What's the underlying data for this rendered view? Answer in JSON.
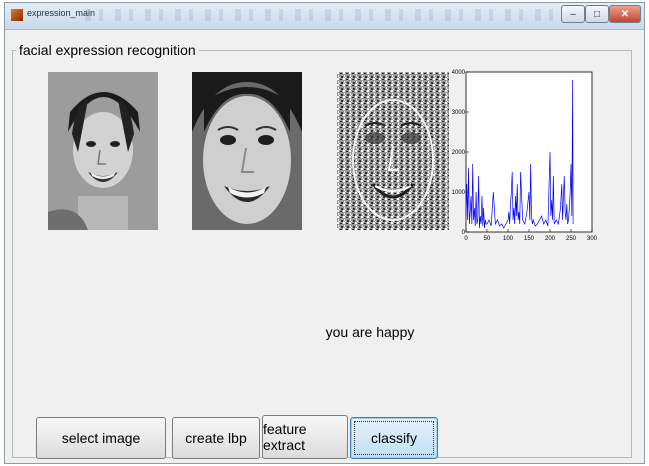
{
  "window": {
    "title": "expression_main"
  },
  "panel": {
    "title": "facial expression recognition"
  },
  "result_text": "you are happy",
  "buttons": {
    "select_image": "select image",
    "create_lbp": "create  lbp",
    "feature_extract": "feature extract",
    "classify": "classify"
  },
  "colors": {
    "series": "#0000ff",
    "classify_button_border": "#3c7fb1"
  },
  "chart_data": {
    "type": "line",
    "title": "",
    "xlabel": "",
    "ylabel": "",
    "xlim": [
      0,
      300
    ],
    "ylim": [
      0,
      4000
    ],
    "xticks": [
      0,
      50,
      100,
      150,
      200,
      250,
      300
    ],
    "yticks": [
      0,
      1000,
      2000,
      3000,
      4000
    ],
    "series": [
      {
        "x": [
          0,
          2,
          4,
          6,
          8,
          10,
          12,
          14,
          16,
          18,
          20,
          22,
          24,
          26,
          28,
          30,
          32,
          34,
          36,
          38,
          40,
          42,
          44,
          46,
          48,
          50,
          55,
          60,
          65,
          70,
          75,
          80,
          85,
          90,
          95,
          100,
          102,
          104,
          106,
          108,
          110,
          112,
          114,
          116,
          118,
          120,
          122,
          124,
          126,
          128,
          130,
          135,
          140,
          145,
          150,
          152,
          154,
          156,
          158,
          160,
          165,
          170,
          175,
          180,
          185,
          190,
          195,
          200,
          202,
          204,
          206,
          208,
          210,
          215,
          220,
          225,
          228,
          230,
          232,
          234,
          236,
          238,
          240,
          242,
          244,
          246,
          248,
          250,
          252,
          254,
          255
        ],
        "values": [
          400,
          1200,
          300,
          1600,
          200,
          500,
          900,
          200,
          1700,
          300,
          600,
          150,
          1000,
          200,
          300,
          1400,
          100,
          400,
          200,
          900,
          150,
          600,
          100,
          300,
          200,
          200,
          300,
          150,
          1000,
          200,
          300,
          150,
          200,
          100,
          200,
          300,
          500,
          200,
          700,
          1000,
          1500,
          300,
          600,
          200,
          900,
          400,
          1200,
          300,
          500,
          200,
          1500,
          300,
          200,
          500,
          1000,
          300,
          1700,
          400,
          200,
          300,
          150,
          200,
          300,
          400,
          200,
          300,
          150,
          2000,
          400,
          800,
          300,
          1400,
          200,
          300,
          200,
          600,
          1200,
          300,
          900,
          1400,
          500,
          300,
          700,
          200,
          300,
          600,
          1000,
          1700,
          400,
          3800,
          200
        ]
      }
    ]
  }
}
